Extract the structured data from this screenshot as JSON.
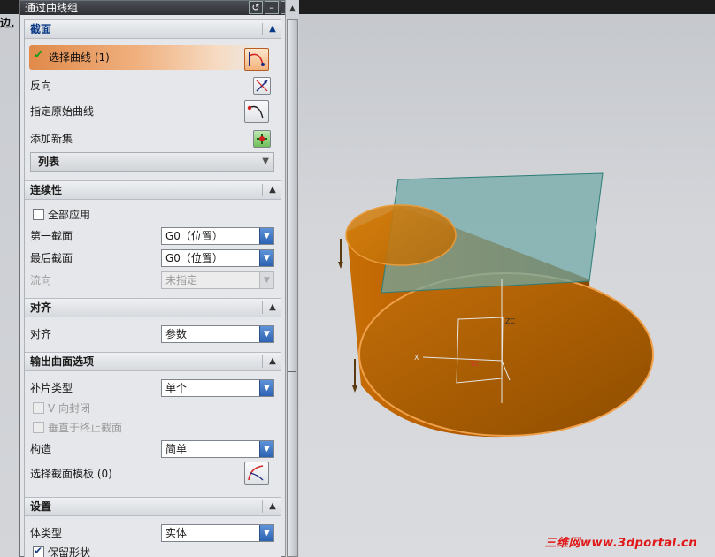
{
  "left_strip": {
    "text": "边,"
  },
  "dialog": {
    "title": "通过曲线组",
    "title_buttons": {
      "reset": "↺",
      "minimize": "–",
      "close": "✕"
    }
  },
  "section": {
    "header": "截面",
    "select_curve": "选择曲线 (1)",
    "reverse": "反向",
    "specify_origin_curve": "指定原始曲线",
    "add_new_set": "添加新集",
    "list": "列表"
  },
  "continuity": {
    "header": "连续性",
    "apply_all": "全部应用",
    "first_section_label": "第一截面",
    "first_section_value": "G0（位置）",
    "last_section_label": "最后截面",
    "last_section_value": "G0（位置）",
    "flow_dir_label": "流向",
    "flow_dir_value": "未指定"
  },
  "alignment": {
    "header": "对齐",
    "label": "对齐",
    "value": "参数"
  },
  "output_surface": {
    "header": "输出曲面选项",
    "patch_type_label": "补片类型",
    "patch_type_value": "单个",
    "v_closed": "V 向封闭",
    "perpendicular": "垂直于终止截面",
    "construction_label": "构造",
    "construction_value": "简单",
    "select_template": "选择截面模板 (0)"
  },
  "settings": {
    "header": "设置",
    "body_type_label": "体类型",
    "body_type_value": "实体",
    "keep_shape": "保留形状"
  },
  "viewport": {
    "axis_x": "X",
    "axis_z": "ZC",
    "axis_y": "YC",
    "watermark": "三维网www.3dportal.cn"
  },
  "icons": {
    "select_curve": "select-curve-icon",
    "reverse": "reverse-direction-icon",
    "specify_origin": "specify-origin-curve-icon",
    "add_set": "add-new-set-icon",
    "template": "section-template-icon"
  }
}
